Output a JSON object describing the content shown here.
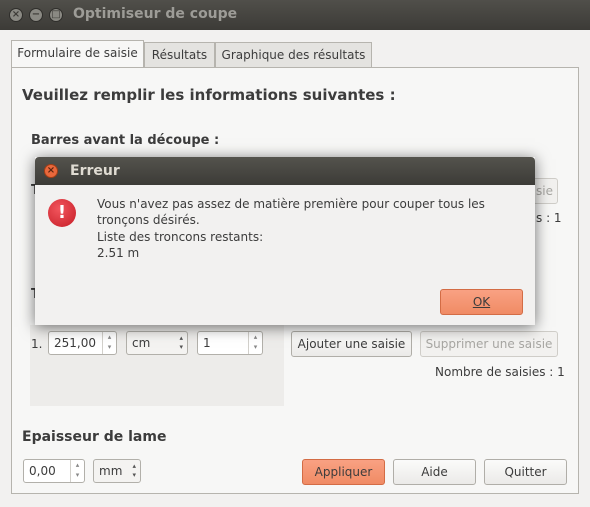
{
  "window": {
    "title": "Optimiseur de coupe"
  },
  "tabs": [
    {
      "label": "Formulaire de saisie"
    },
    {
      "label": "Résultats"
    },
    {
      "label": "Graphique des résultats"
    }
  ],
  "form": {
    "intro": "Veuillez remplir les informations suivantes :",
    "bars_section": "Barres avant la découpe :",
    "bars_partial_letter": "T",
    "bars_count_partial": "s : 1",
    "bars_remove_partial": "isie",
    "cuts_partial_letter": "T",
    "row_index": "1.",
    "length_value": "251,00",
    "unit_value": "cm",
    "quantity_value": "1",
    "add_button": "Ajouter une saisie",
    "remove_button": "Supprimer une saisie",
    "count_label": "Nombre de saisies : 1",
    "blade_section": "Epaisseur de lame",
    "blade_value": "0,00",
    "blade_unit": "mm",
    "apply_button": "Appliquer",
    "help_button": "Aide",
    "quit_button": "Quitter"
  },
  "dialog": {
    "title": "Erreur",
    "icon": "error-icon",
    "message_line1": "Vous n'avez pas assez de matière première pour couper tous les",
    "message_line2": "tronçons désirés.",
    "message_line3": "Liste des troncons restants:",
    "message_line4": "2.51 m",
    "ok_button": "OK"
  },
  "colors": {
    "accent": "#f08b64",
    "titlebar": "#3c3b37",
    "error": "#c51d26"
  }
}
